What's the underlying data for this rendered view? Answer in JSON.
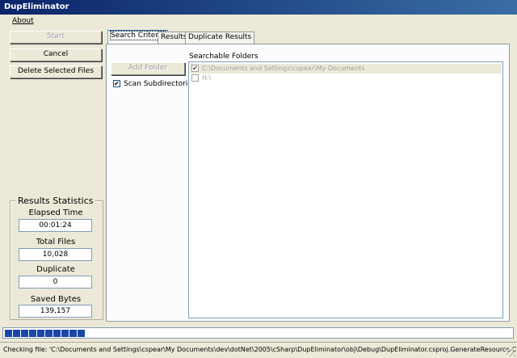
{
  "window": {
    "title": "DupEliminator"
  },
  "menu": {
    "about": "About"
  },
  "buttons": {
    "start": "Start",
    "cancel": "Cancel",
    "delete_selected": "Delete Selected Files",
    "add_folder": "Add Folder"
  },
  "stats": {
    "title": "Results Statistics",
    "elapsed_label": "Elapsed Time",
    "elapsed_value": "00:01:24",
    "total_label": "Total Files",
    "total_value": "10,028",
    "duplicate_label": "Duplicate",
    "duplicate_value": "0",
    "saved_label": "Saved Bytes",
    "saved_value": "139,157"
  },
  "tabs": [
    "Search Criteria",
    "Results",
    "Duplicate Results"
  ],
  "options": {
    "scan_subdirectories": "Scan Subdirectories",
    "scan_subdirectories_checked": true
  },
  "folders": {
    "label": "Searchable Folders",
    "items": [
      {
        "path": "C:\\Documents and Settings\\cspear\\My Documents",
        "checked": true
      },
      {
        "path": "H:\\",
        "checked": false
      }
    ]
  },
  "progress": {
    "segments_filled": 10,
    "accent": "#1b47a8"
  },
  "status": {
    "text": "Checking file: 'C:\\Documents and Settings\\cspear\\My Documents\\dev\\dotNet\\2005\\cSharp\\DupEliminator\\obj\\Debug\\DupEliminator.csproj.GenerateResource.Cache'"
  }
}
